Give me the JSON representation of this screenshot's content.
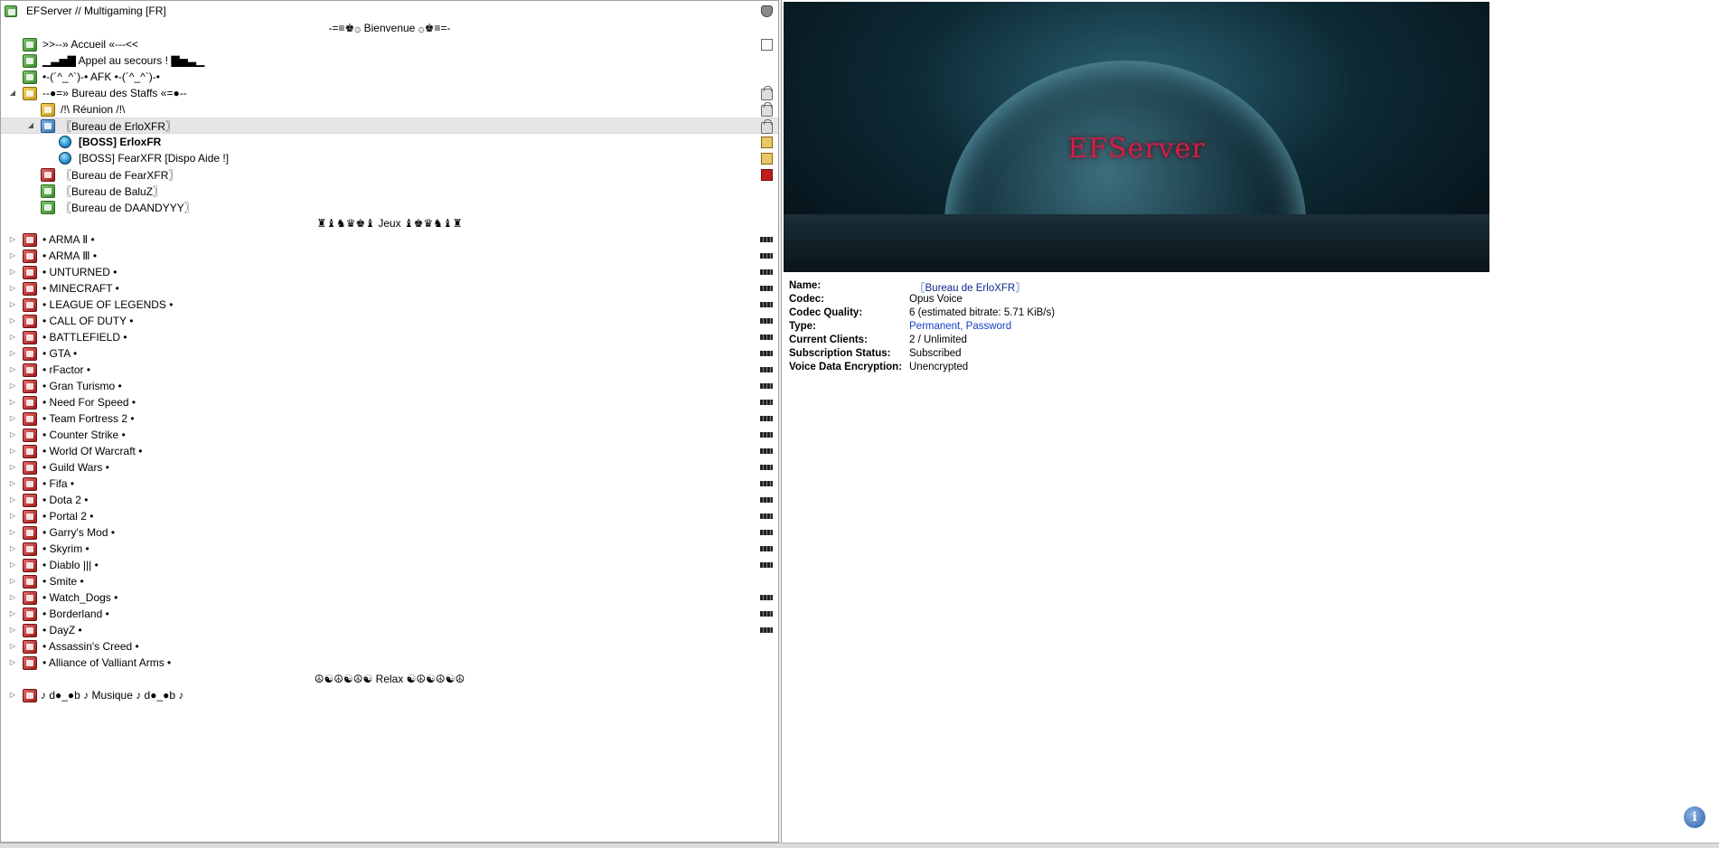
{
  "server": {
    "title": "EFServer // Multigaming [FR]"
  },
  "tree": {
    "welcome_header": "-=≡♚۞ Bienvenue ۞♚≡=-",
    "accueil": ">>--» Accueil «---<<",
    "appel": "▁▃▅▇ Appel au secours ! ▇▅▃▁",
    "afk": "•-(´^_^`)-• AFK •-(´^_^`)-•",
    "staff_office": "--●=» Bureau des Staffs «=●--",
    "reunion": "/!\\ Réunion /!\\",
    "bureau_erlox": "〖Bureau de ErloXFR〗",
    "client1": "[BOSS] ErloxFR",
    "client2": "[BOSS] FearXFR [Dispo Aide !]",
    "bureau_fear": "〖Bureau de FearXFR〗",
    "bureau_baluz": "〖Bureau de BaluZ〗",
    "bureau_daandyyy": "〖Bureau de DAANDYYY〗",
    "jeux_header": "♜♝♞♛♚♝ Jeux ♝♚♛♞♝♜",
    "games": [
      "• ARMA Ⅱ •",
      "• ARMA Ⅲ •",
      "• UNTURNED •",
      "• MINECRAFT •",
      "• LEAGUE OF LEGENDS •",
      "• CALL OF DUTY •",
      "• BATTLEFIELD •",
      "• GTA •",
      "• rFactor •",
      "• Gran Turismo •",
      "• Need For Speed •",
      "• Team Fortress 2 •",
      "• Counter Strike •",
      "• World Of Warcraft •",
      "• Guild Wars •",
      "• Fifa •",
      "• Dota 2 •",
      "• Portal 2 •",
      "• Garry's Mod •",
      "• Skyrim •",
      "• Diablo ||| •",
      "• Smite •",
      "• Watch_Dogs •",
      "• Borderland •",
      "• DayZ •",
      "• Assassin's Creed •",
      "• Alliance of Valliant Arms •"
    ],
    "relax_header": "☮☯☮☯☮☯ Relax ☯☮☯☮☯☮",
    "musique": "♪ d●_●b ♪ Musique ♪ d●_●b ♪"
  },
  "banner": {
    "text": "EFServer"
  },
  "info": {
    "name_label": "Name:",
    "name_value": "〖Bureau de ErloXFR〗",
    "codec_label": "Codec:",
    "codec_value": "Opus Voice",
    "quality_label": "Codec Quality:",
    "quality_value": "6 (estimated bitrate: 5.71 KiB/s)",
    "type_label": "Type:",
    "type_value": "Permanent, Password",
    "clients_label": "Current Clients:",
    "clients_value": "2 / Unlimited",
    "subscription_label": "Subscription Status:",
    "subscription_value": "Subscribed",
    "encryption_label": "Voice Data Encryption:",
    "encryption_value": "Unencrypted"
  }
}
